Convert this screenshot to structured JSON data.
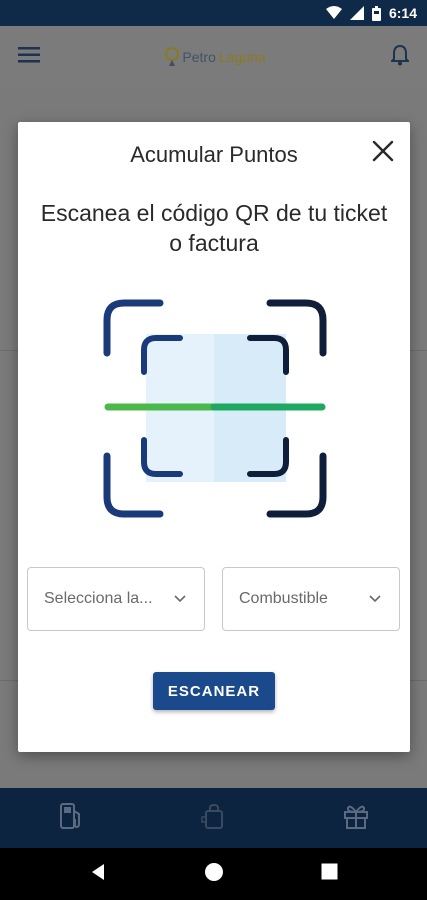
{
  "status_bar": {
    "time": "6:14",
    "icons": [
      "wifi-icon",
      "signal-icon",
      "battery-icon"
    ]
  },
  "app_bar": {
    "logo_part1": "Petro",
    "logo_part2": "Laguna",
    "icons": [
      "menu-icon",
      "bell-icon"
    ]
  },
  "modal": {
    "title": "Acumular Puntos",
    "subtitle": "Escanea el código QR de tu ticket o factura",
    "select_station": {
      "value": "Selecciona la..."
    },
    "select_type": {
      "value": "Combustible"
    },
    "scan_button": "ESCANEAR"
  },
  "bottom_nav": {
    "icons": [
      "fuel-pump-icon",
      "shopping-bag-icon",
      "gift-icon"
    ]
  },
  "colors": {
    "primary": "#1a4a8c",
    "dark_navy": "#0f2948",
    "scan_line": "#3cb04a",
    "qr_fill": "#dceef8"
  }
}
